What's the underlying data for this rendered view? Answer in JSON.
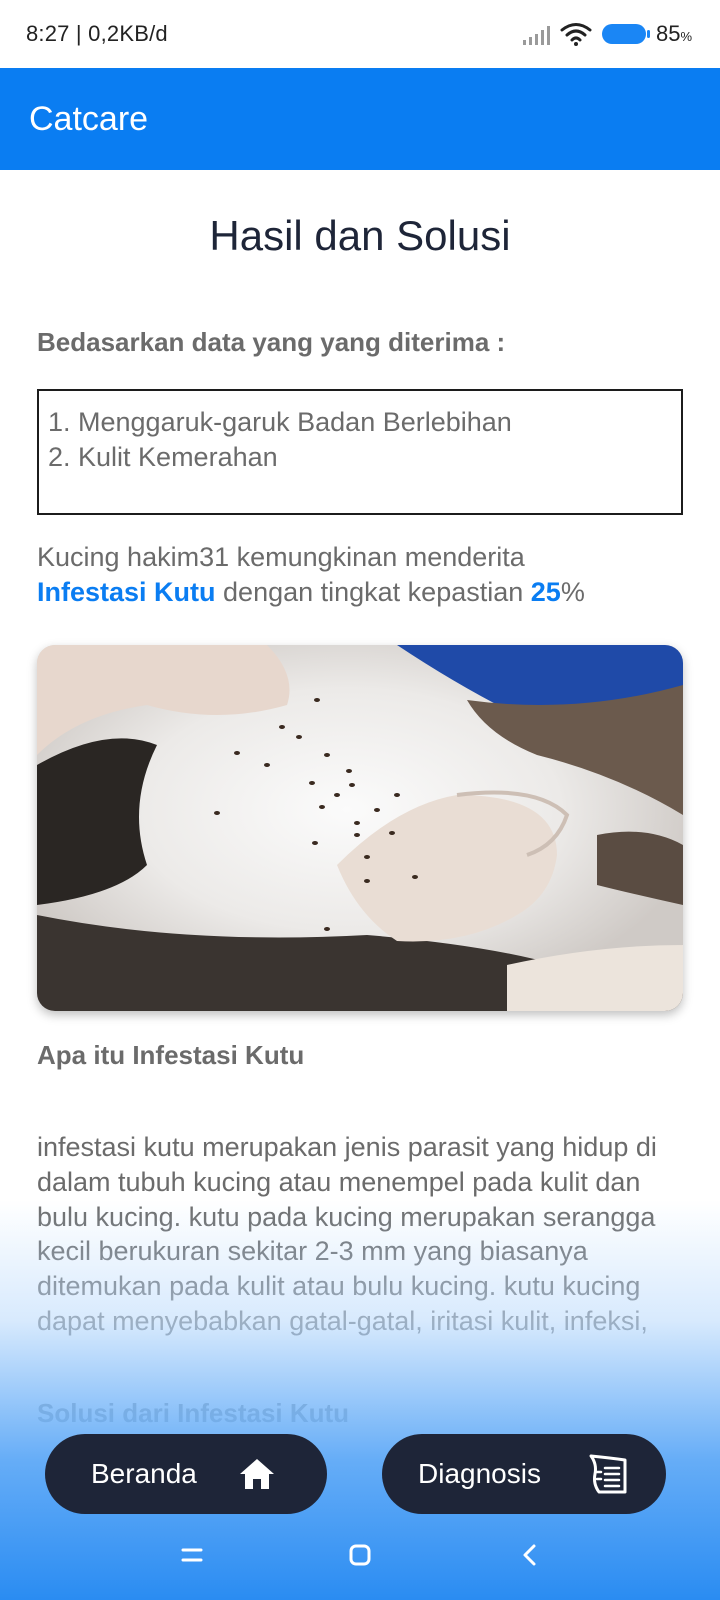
{
  "status_bar": {
    "time_speed": "8:27 | 0,2KB/d",
    "battery": "85",
    "battery_unit": "%"
  },
  "app_bar": {
    "title": "Catcare"
  },
  "page": {
    "title": "Hasil dan Solusi",
    "data_label": "Bedasarkan data yang yang diterima :",
    "symptoms": [
      "1. Menggaruk-garuk Badan Berlebihan",
      "2. Kulit Kemerahan"
    ],
    "result": {
      "prefix": "Kucing hakim31 kemungkinan menderita",
      "disease": "Infestasi Kutu",
      "middle": " dengan tingkat kepastian ",
      "certainty": "25",
      "suffix": "%"
    },
    "what_is_heading": "Apa itu Infestasi Kutu",
    "description": "infestasi kutu merupakan jenis parasit yang hidup di dalam tubuh kucing atau menempel pada kulit dan bulu kucing. kutu pada kucing merupakan serangga kecil berukuran sekitar 2-3 mm yang biasanya ditemukan pada kulit atau bulu kucing. kutu kucing dapat menyebabkan gatal-gatal, iritasi kulit, infeksi,",
    "solution_heading": "Solusi dari Infestasi Kutu"
  },
  "bottom_nav": {
    "home_label": "Beranda",
    "home_icon": "home-icon",
    "diagnosis_label": "Diagnosis",
    "diagnosis_icon": "clipboard-list-icon"
  },
  "colors": {
    "accent": "#0a7df2",
    "dark": "#1e2538",
    "text": "#6b6b6b"
  }
}
